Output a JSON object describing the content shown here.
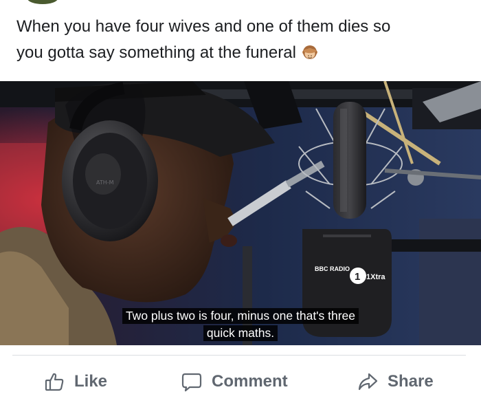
{
  "post": {
    "text_line1": "When you have four wives and one of them dies so",
    "text_line2": "you gotta say something at the funeral",
    "emoji": "see-no-evil-monkey-icon"
  },
  "photo": {
    "subtitle_line1": "Two plus two is four, minus one that's three",
    "subtitle_line2": "quick maths.",
    "mic_logo_left": "BBC RADIO",
    "mic_logo_right": "1Xtra"
  },
  "actions": {
    "like_label": "Like",
    "comment_label": "Comment",
    "share_label": "Share"
  },
  "colors": {
    "text": "#1c1e21",
    "muted": "#606770",
    "divider": "#dadde1"
  }
}
